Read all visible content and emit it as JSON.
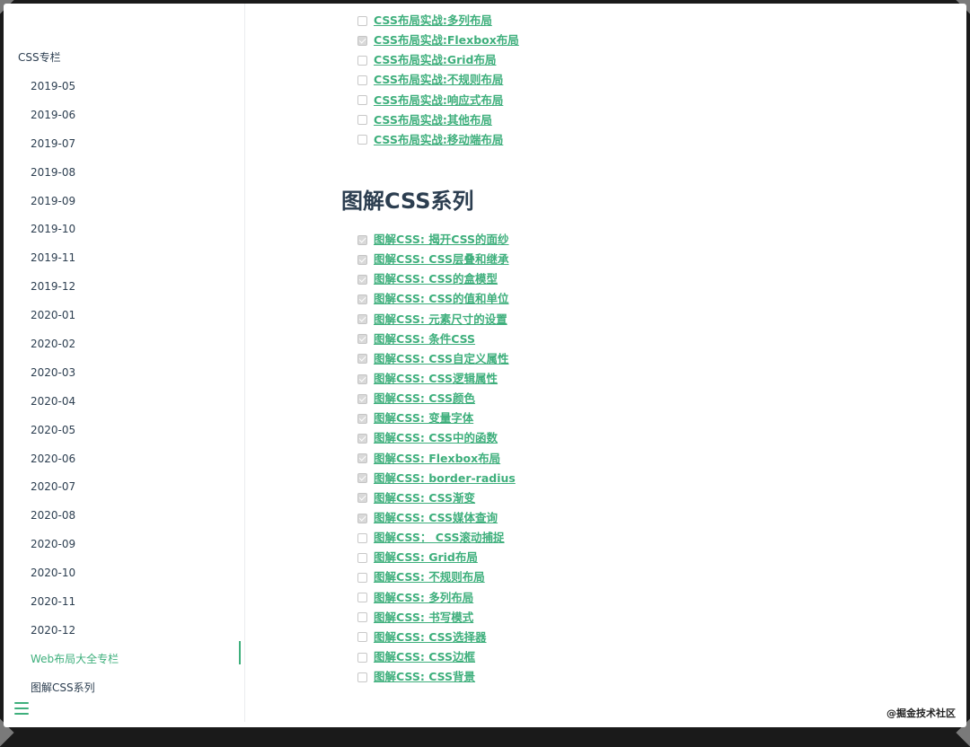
{
  "sidebar": {
    "section_title": "CSS专栏",
    "items": [
      {
        "label": "2019-05",
        "active": false
      },
      {
        "label": "2019-06",
        "active": false
      },
      {
        "label": "2019-07",
        "active": false
      },
      {
        "label": "2019-08",
        "active": false
      },
      {
        "label": "2019-09",
        "active": false
      },
      {
        "label": "2019-10",
        "active": false
      },
      {
        "label": "2019-11",
        "active": false
      },
      {
        "label": "2019-12",
        "active": false
      },
      {
        "label": "2020-01",
        "active": false
      },
      {
        "label": "2020-02",
        "active": false
      },
      {
        "label": "2020-03",
        "active": false
      },
      {
        "label": "2020-04",
        "active": false
      },
      {
        "label": "2020-05",
        "active": false
      },
      {
        "label": "2020-06",
        "active": false
      },
      {
        "label": "2020-07",
        "active": false
      },
      {
        "label": "2020-08",
        "active": false
      },
      {
        "label": "2020-09",
        "active": false
      },
      {
        "label": "2020-10",
        "active": false
      },
      {
        "label": "2020-11",
        "active": false
      },
      {
        "label": "2020-12",
        "active": false
      },
      {
        "label": "Web布局大全专栏",
        "active": true
      },
      {
        "label": "图解CSS系列",
        "active": false
      }
    ],
    "menu_icon": "hamburger-menu-icon"
  },
  "content": {
    "layout_tasks": [
      {
        "label": "CSS布局实战:多列布局",
        "checked": false
      },
      {
        "label": "CSS布局实战:Flexbox布局",
        "checked": true
      },
      {
        "label": "CSS布局实战:Grid布局",
        "checked": false
      },
      {
        "label": "CSS布局实战:不规则布局",
        "checked": false
      },
      {
        "label": "CSS布局实战:响应式布局",
        "checked": false
      },
      {
        "label": "CSS布局实战:其他布局",
        "checked": false
      },
      {
        "label": "CSS布局实战:移动端布局",
        "checked": false
      }
    ],
    "section_title": "图解CSS系列",
    "series_tasks": [
      {
        "label": "图解CSS: 揭开CSS的面纱",
        "checked": true
      },
      {
        "label": "图解CSS: CSS层叠和继承",
        "checked": true
      },
      {
        "label": "图解CSS: CSS的盒模型",
        "checked": true
      },
      {
        "label": "图解CSS: CSS的值和单位",
        "checked": true
      },
      {
        "label": "图解CSS: 元素尺寸的设置",
        "checked": true
      },
      {
        "label": "图解CSS: 条件CSS",
        "checked": true
      },
      {
        "label": "图解CSS: CSS自定义属性",
        "checked": true
      },
      {
        "label": "图解CSS: CSS逻辑属性",
        "checked": true
      },
      {
        "label": "图解CSS: CSS颜色",
        "checked": true
      },
      {
        "label": "图解CSS: 变量字体",
        "checked": true
      },
      {
        "label": "图解CSS: CSS中的函数",
        "checked": true
      },
      {
        "label": "图解CSS: Flexbox布局",
        "checked": true
      },
      {
        "label": "图解CSS: border-radius",
        "checked": true
      },
      {
        "label": "图解CSS: CSS渐变",
        "checked": true
      },
      {
        "label": "图解CSS: CSS媒体查询",
        "checked": true
      },
      {
        "label": "图解CSS： CSS滚动捕捉",
        "checked": false
      },
      {
        "label": "图解CSS: Grid布局",
        "checked": false
      },
      {
        "label": "图解CSS: 不规则布局",
        "checked": false
      },
      {
        "label": "图解CSS: 多列布局",
        "checked": false
      },
      {
        "label": "图解CSS: 书写模式",
        "checked": false
      },
      {
        "label": "图解CSS: CSS选择器",
        "checked": false
      },
      {
        "label": "图解CSS: CSS边框",
        "checked": false
      },
      {
        "label": "图解CSS: CSS背景",
        "checked": false
      }
    ]
  },
  "watermark": "@掘金技术社区",
  "colors": {
    "accent": "#3eaf7c",
    "text": "#2c3e50",
    "border": "#eaecef"
  }
}
